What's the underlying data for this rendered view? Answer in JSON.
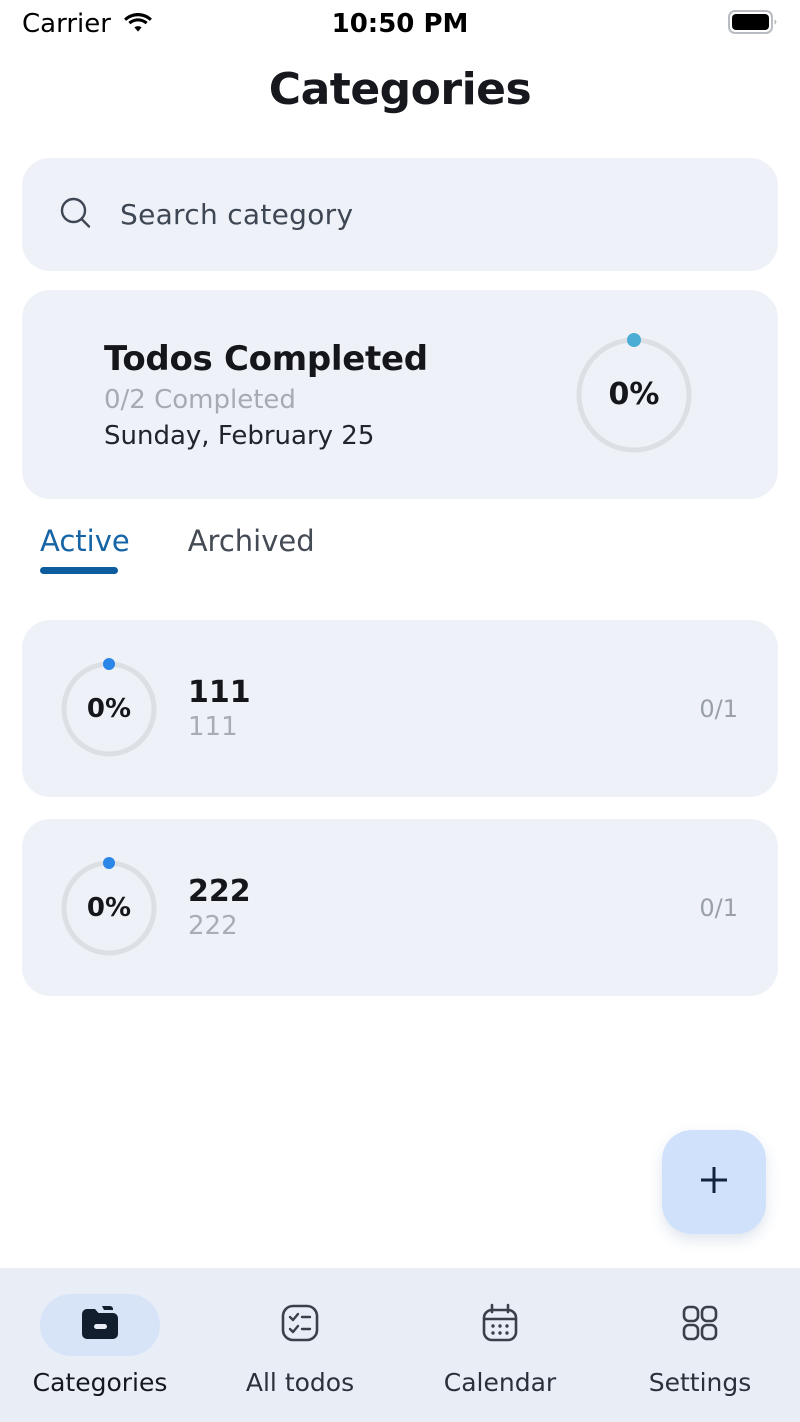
{
  "status_bar": {
    "carrier": "Carrier",
    "wifi_icon": "wifi-icon",
    "time": "10:50 PM",
    "battery_icon": "battery-full-icon"
  },
  "header": {
    "title": "Categories"
  },
  "search": {
    "icon": "search-icon",
    "placeholder": "Search category",
    "value": ""
  },
  "summary": {
    "title": "Todos Completed",
    "subtitle": "0/2 Completed",
    "date": "Sunday, February 25",
    "progress_label": "0%",
    "progress_percent": 0,
    "ring_track_color": "#dcdfe3",
    "ring_dot_color": "#4badd4"
  },
  "tabs": [
    {
      "label": "Active",
      "selected": true
    },
    {
      "label": "Archived",
      "selected": false
    }
  ],
  "categories": [
    {
      "title": "111",
      "subtitle": "111",
      "count": "0/1",
      "progress_label": "0%",
      "progress_percent": 0
    },
    {
      "title": "222",
      "subtitle": "222",
      "count": "0/1",
      "progress_label": "0%",
      "progress_percent": 0
    }
  ],
  "list_ring": {
    "track_color": "#dcdfe3",
    "dot_color": "#2b86e8"
  },
  "fab": {
    "icon": "plus-icon",
    "background": "#cfe1fb"
  },
  "bottom_nav": {
    "items": [
      {
        "label": "Categories",
        "icon": "folder-icon",
        "active": true
      },
      {
        "label": "All todos",
        "icon": "checklist-icon",
        "active": false
      },
      {
        "label": "Calendar",
        "icon": "calendar-icon",
        "active": false
      },
      {
        "label": "Settings",
        "icon": "grid-icon",
        "active": false
      }
    ]
  },
  "theme": {
    "card_background": "#eef2f8",
    "accent": "#0d5c9e",
    "nav_background": "#e9eef6"
  }
}
